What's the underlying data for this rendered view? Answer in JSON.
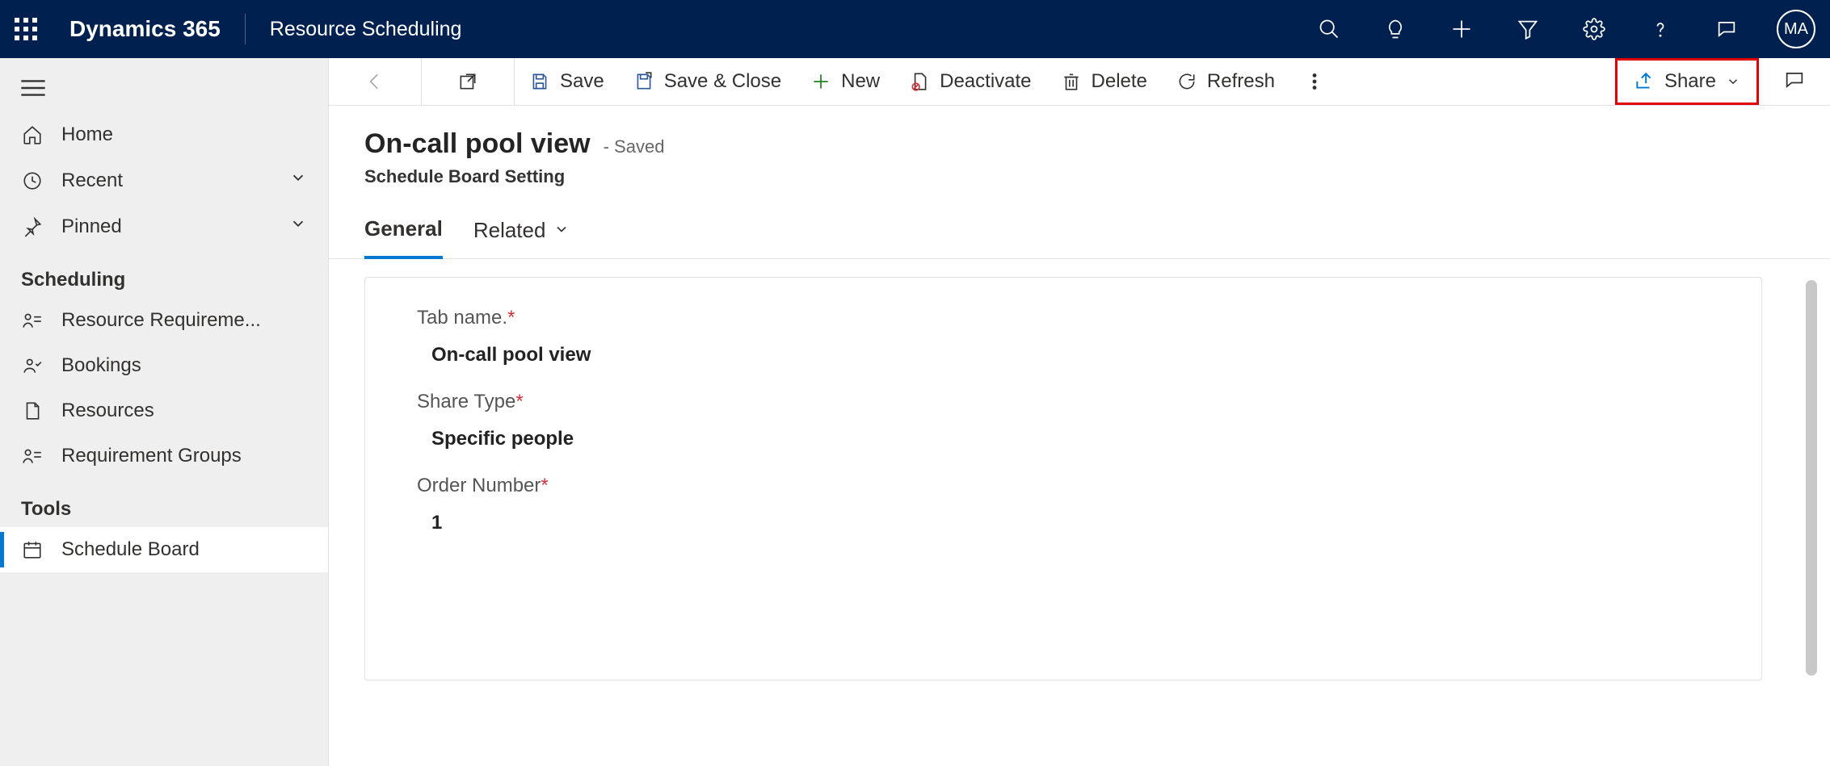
{
  "header": {
    "brand": "Dynamics 365",
    "app": "Resource Scheduling",
    "avatar_initials": "MA"
  },
  "sidebar": {
    "home": "Home",
    "recent": "Recent",
    "pinned": "Pinned",
    "section_scheduling": "Scheduling",
    "resource_req": "Resource Requireme...",
    "bookings": "Bookings",
    "resources": "Resources",
    "req_groups": "Requirement Groups",
    "section_tools": "Tools",
    "schedule_board": "Schedule Board"
  },
  "cmdbar": {
    "save": "Save",
    "save_close": "Save & Close",
    "new": "New",
    "deactivate": "Deactivate",
    "delete": "Delete",
    "refresh": "Refresh",
    "share": "Share"
  },
  "record": {
    "title": "On-call pool view",
    "status": "- Saved",
    "subtitle": "Schedule Board Setting"
  },
  "tabs": {
    "general": "General",
    "related": "Related"
  },
  "form": {
    "tab_name_label": "Tab name.",
    "tab_name_value": "On-call pool view",
    "share_type_label": "Share Type",
    "share_type_value": "Specific people",
    "order_number_label": "Order Number",
    "order_number_value": "1"
  }
}
